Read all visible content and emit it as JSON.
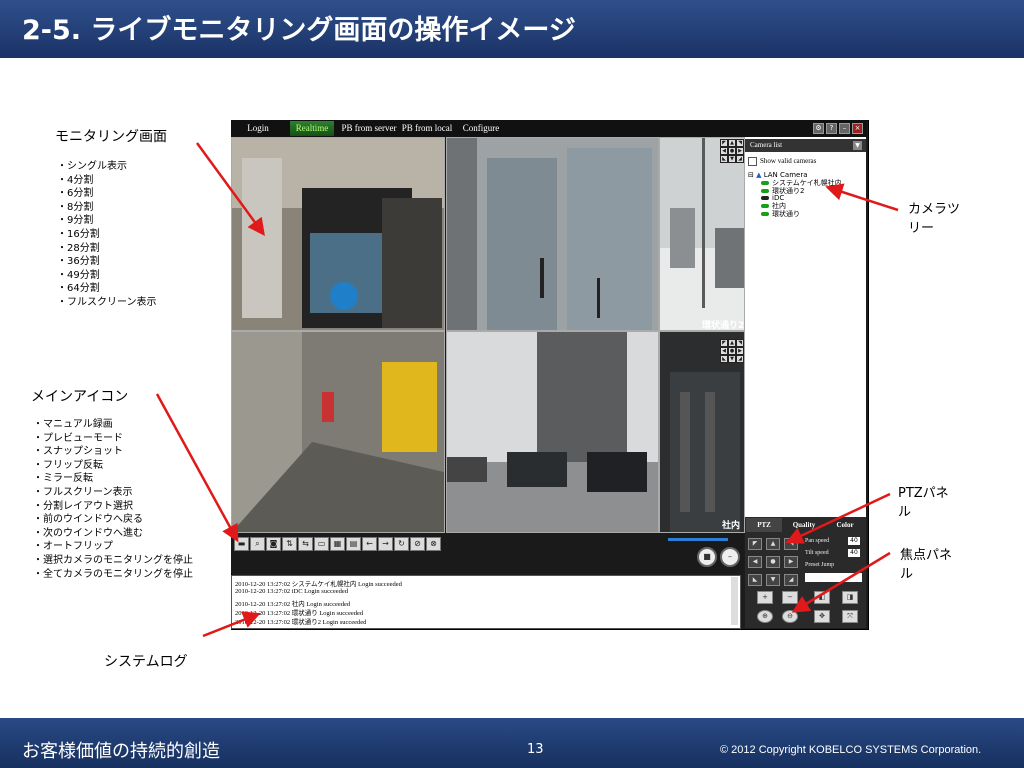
{
  "slide": {
    "title": "2-5. ライブモニタリング画面の操作イメージ",
    "footer_left": "お客様価値の持続的創造",
    "page_number": "13",
    "copyright": "© 2012 Copyright  KOBELCO SYSTEMS Corporation."
  },
  "annotations": {
    "monitor": {
      "title": "モニタリング画面",
      "items": [
        "・シングル表示",
        "・4分割",
        "・6分割",
        "・8分割",
        "・9分割",
        "・16分割",
        "・28分割",
        "・36分割",
        "・49分割",
        "・64分割",
        "・フルスクリーン表示"
      ]
    },
    "icons": {
      "title": "メインアイコン",
      "items": [
        "・マニュアル録画",
        "・プレビューモード",
        "・スナップショット",
        "・フリップ反転",
        "・ミラー反転",
        "・フルスクリーン表示",
        "・分割レイアウト選択",
        "・前のウインドウへ戻る",
        "・次のウインドウへ進む",
        "・オートフリップ",
        "・選択カメラのモニタリングを停止",
        "・全てカメラのモニタリングを停止"
      ]
    },
    "camera_tree": {
      "line1": "カメラツ",
      "line2": "リー"
    },
    "ptz_panel": {
      "line1": "PTZパネ",
      "line2": "ル"
    },
    "focus_panel": {
      "line1": "焦点パネ",
      "line2": "ル"
    },
    "system_log": "システムログ"
  },
  "app": {
    "menu": [
      "Login",
      "Realtime",
      "PB from server",
      "PB from local",
      "Configure"
    ],
    "active_menu": "Realtime",
    "camera_list": {
      "header": "Camera list",
      "show_valid": "Show valid cameras",
      "root": "LAN Camera",
      "cameras": [
        "システムケイ札幌社内",
        "環状通り2",
        "iDC",
        "社内",
        "環状通り"
      ]
    },
    "tile_labels": {
      "tile3": "環状通り2",
      "tile6": "社内"
    },
    "log_lines": [
      "2010-12-20 13:27:02  システムケイ札幌社内  Login succeeded",
      "2010-12-20 13:27:02  iDC  Login succeeded",
      "2010-12-20 13:27:02  社内  Login succeeded",
      "2010-12-20 13:27:02  環状通り  Login succeeded",
      "2010-12-20 13:27:02  環状通り2  Login succeeded"
    ],
    "ptz": {
      "tabs": [
        "PTZ",
        "Quality",
        "Color"
      ],
      "pan_speed_label": "Pan speed",
      "pan_speed": "40",
      "tilt_speed_label": "Tilt speed",
      "tilt_speed": "40",
      "preset_label": "Preset Jump"
    },
    "colors": {
      "accent_green": "#16a016",
      "active_tab": "#b8ff7a"
    }
  }
}
